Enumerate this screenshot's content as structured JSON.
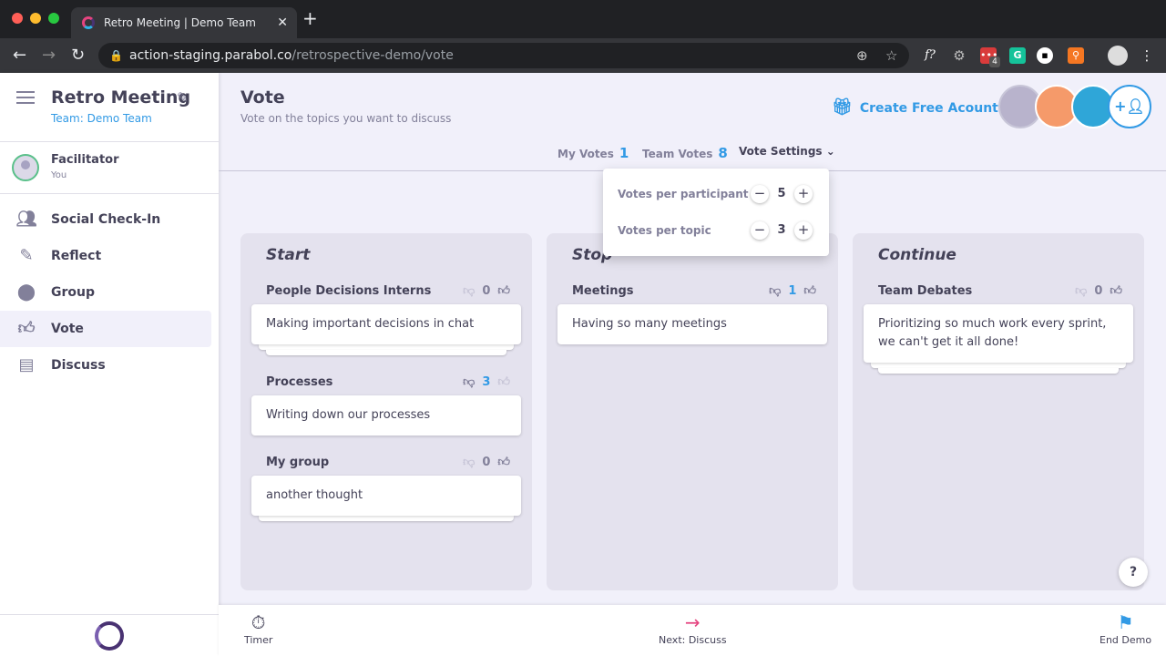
{
  "browser": {
    "tab_title": "Retro Meeting | Demo Team",
    "url_host": "action-staging.parabol.co",
    "url_path": "/retrospective-demo/vote",
    "ext_badge": "4"
  },
  "sidebar": {
    "meeting_title": "Retro Meeting",
    "team": "Team: Demo Team",
    "facilitator": "Facilitator",
    "facilitator_sub": "You",
    "items": [
      {
        "label": "Social Check-In",
        "icon": "group-icon"
      },
      {
        "label": "Reflect",
        "icon": "pencil-icon"
      },
      {
        "label": "Group",
        "icon": "group-circle-icon"
      },
      {
        "label": "Vote",
        "icon": "thumbs-icon"
      },
      {
        "label": "Discuss",
        "icon": "chat-icon"
      }
    ],
    "active": "Vote"
  },
  "header": {
    "title": "Vote",
    "subtitle": "Vote on the topics you want to discuss",
    "create_account": "Create Free Acount"
  },
  "votes": {
    "my_label": "My Votes",
    "my": "1",
    "team_label": "Team Votes",
    "team": "8",
    "settings_label": "Vote Settings"
  },
  "settings": {
    "per_participant_label": "Votes per participant",
    "per_participant": "5",
    "per_topic_label": "Votes per topic",
    "per_topic": "3"
  },
  "columns": [
    {
      "title": "Start",
      "groups": [
        {
          "title": "People Decisions Interns",
          "votes": "0",
          "card": "Making important decisions in chat",
          "stack": 2
        },
        {
          "title": "Processes",
          "votes": "3",
          "card": "Writing down our processes",
          "stack": 0
        },
        {
          "title": "My group",
          "votes": "0",
          "card": "another thought",
          "stack": 1
        }
      ]
    },
    {
      "title": "Stop",
      "groups": [
        {
          "title": "Meetings",
          "votes": "1",
          "card": "Having so many meetings",
          "stack": 0
        }
      ]
    },
    {
      "title": "Continue",
      "groups": [
        {
          "title": "Team Debates",
          "votes": "0",
          "card": " Prioritizing so much work every sprint, we can't get it all done!",
          "stack": 2
        }
      ]
    }
  ],
  "footer": {
    "timer": "Timer",
    "next": "Next: Discuss",
    "end": "End Demo"
  },
  "colors": {
    "accent": "#329ae5",
    "text": "#444258",
    "muted": "#82809a",
    "bg": "#f1f0fa"
  }
}
